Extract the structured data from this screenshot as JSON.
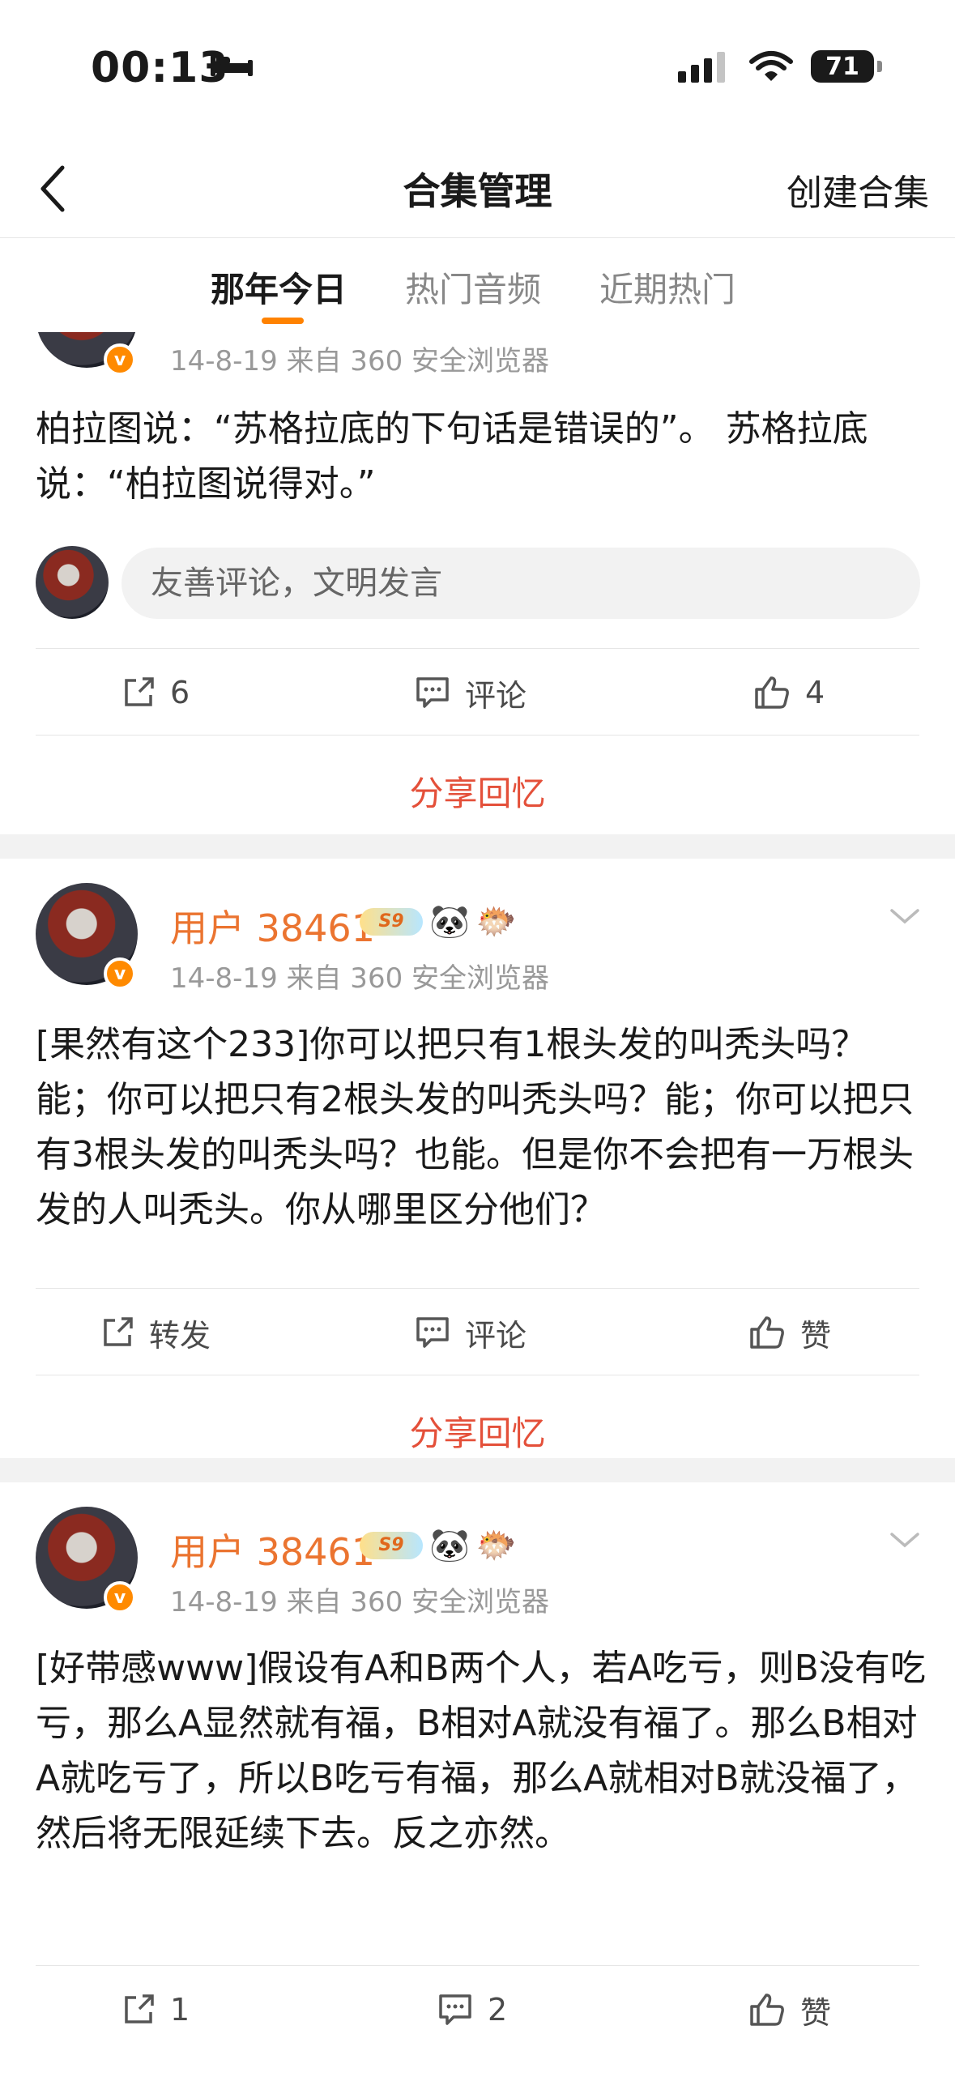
{
  "status_bar": {
    "time": "00:13",
    "battery": "71"
  },
  "nav": {
    "title": "合集管理",
    "action": "创建合集"
  },
  "tabs": [
    {
      "label": "那年今日",
      "active": true
    },
    {
      "label": "热门音频",
      "active": false
    },
    {
      "label": "近期热门",
      "active": false
    }
  ],
  "posts": [
    {
      "meta": "14-8-19  来自 360 安全浏览器",
      "text": "柏拉图说：“苏格拉底的下句话是错误的”。 苏格拉底说：“柏拉图说得对。”",
      "comment_placeholder": "友善评论，文明发言",
      "repost": "6",
      "comment": "评论",
      "like": "4",
      "share_memory": "分享回忆"
    },
    {
      "username": "用户 38461",
      "badge": "S9",
      "meta": "14-8-19  来自 360 安全浏览器",
      "text": "[果然有这个233]你可以把只有1根头发的叫秃头吗？能；你可以把只有2根头发的叫秃头吗？能；你可以把只有3根头发的叫秃头吗？也能。但是你不会把有一万根头发的人叫秃头。你从哪里区分他们？",
      "repost": "转发",
      "comment": "评论",
      "like": "赞",
      "share_memory": "分享回忆"
    },
    {
      "username": "用户 38461",
      "badge": "S9",
      "meta": "14-8-19  来自 360 安全浏览器",
      "text": "[好带感www]假设有A和B两个人，若A吃亏，则B没有吃亏，那么A显然就有福，B相对A就没有福了。那么B相对A就吃亏了，所以B吃亏有福，那么A就相对B就没福了，然后将无限延续下去。反之亦然。",
      "repost": "1",
      "comment": "2",
      "like": "赞"
    }
  ],
  "colors": {
    "accent": "#ff8200",
    "username": "#eb7430",
    "share": "#e4503a"
  }
}
